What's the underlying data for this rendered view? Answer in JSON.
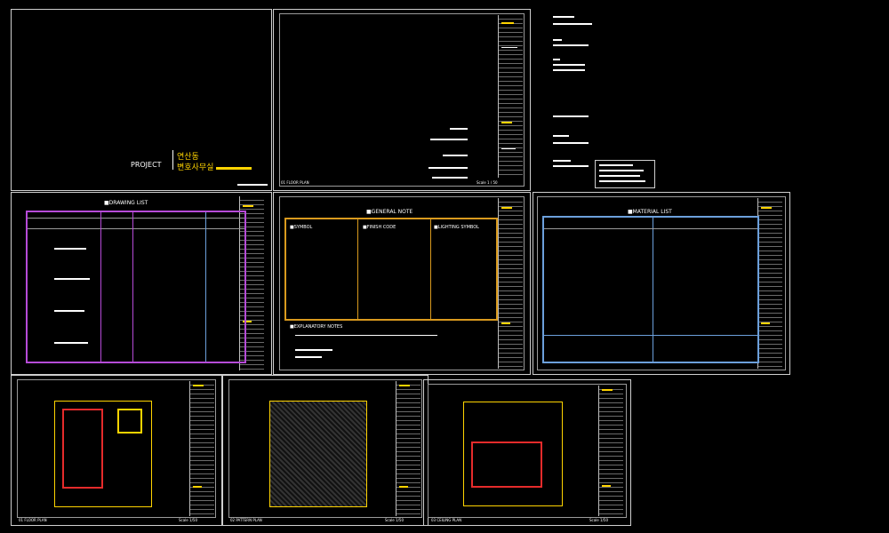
{
  "colors": {
    "background": "#000000",
    "sheet": "#cfcfcf",
    "accent_yellow": "#ffd400",
    "purple": "#b64bd8",
    "blue": "#6ca0dc",
    "orange": "#d99a1e",
    "red": "#e52b2b"
  },
  "cover": {
    "project_label": "PROJECT",
    "korean_line1": "연산동",
    "korean_line2": "변호사무실"
  },
  "sheets": {
    "floor_plan_cover": {
      "footer_left": "01 FLOOR PLAN",
      "footer_right": "Scale 1 / 50"
    },
    "drawing_list": {
      "title": "■DRAWING LIST"
    },
    "general_note": {
      "title": "■GENERAL NOTE",
      "symbol": "■SYMBOL",
      "finish_code": "■FINISH CODE",
      "lighting": "■LIGHTING SYMBOL",
      "explanatory": "■EXPLANATORY NOTES"
    },
    "material_list": {
      "title": "■MATERIAL LIST"
    },
    "floor_plan": {
      "footer_left": "01 FLOOR PLAN",
      "footer_right": "Scale 1/50"
    },
    "pattern_plan": {
      "footer_left": "02 PATTERN PLAN",
      "footer_right": "Scale 1/50"
    },
    "ceiling_plan": {
      "footer_left": "03 CEILING PLAN",
      "footer_right": "Scale 1/50"
    }
  }
}
